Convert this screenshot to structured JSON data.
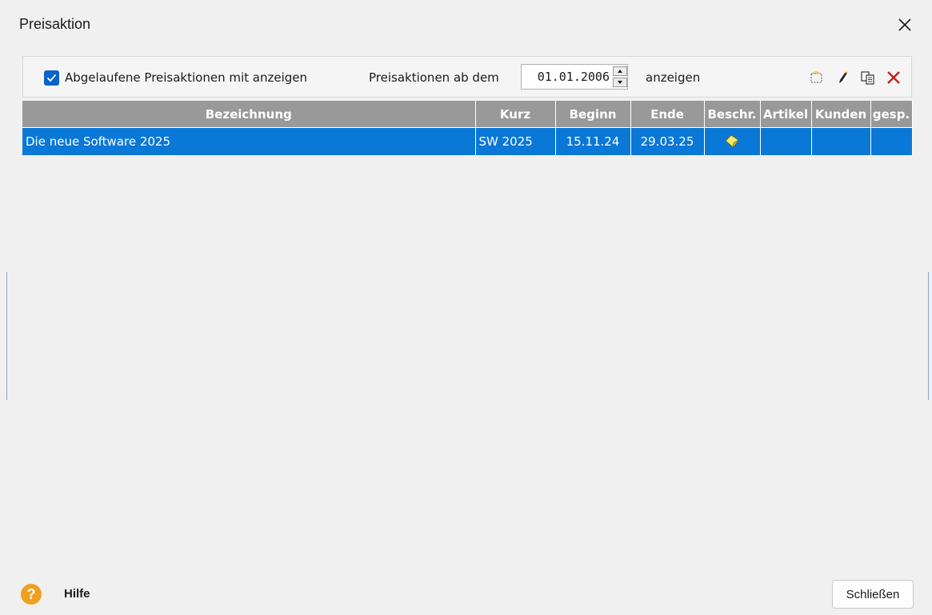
{
  "window": {
    "title": "Preisaktion"
  },
  "toolbar": {
    "show_expired_label": "Abgelaufene Preisaktionen mit anzeigen",
    "show_expired_checked": true,
    "date_label": "Preisaktionen ab dem",
    "date_value": "01.01.2006",
    "date_suffix": "anzeigen",
    "icons": [
      "new-icon",
      "edit-icon",
      "copy-icon",
      "delete-icon"
    ]
  },
  "table": {
    "columns": [
      "Bezeichnung",
      "Kurz",
      "Beginn",
      "Ende",
      "Beschr.",
      "Artikel",
      "Kunden",
      "gesp."
    ],
    "rows": [
      {
        "bezeichnung": "Die neue Software 2025",
        "kurz": "SW 2025",
        "beginn": "15.11.24",
        "ende": "29.03.25",
        "beschr_icon": "note-icon",
        "artikel": "",
        "kunden": "",
        "gesp": ""
      }
    ]
  },
  "footer": {
    "help_label": "Hilfe",
    "close_label": "Schließen"
  },
  "colors": {
    "selected_row": "#0a78d7",
    "header_bg": "#999999",
    "checkbox": "#0a64c8",
    "help_icon": "#f0a020",
    "delete_icon": "#c81e1e"
  }
}
